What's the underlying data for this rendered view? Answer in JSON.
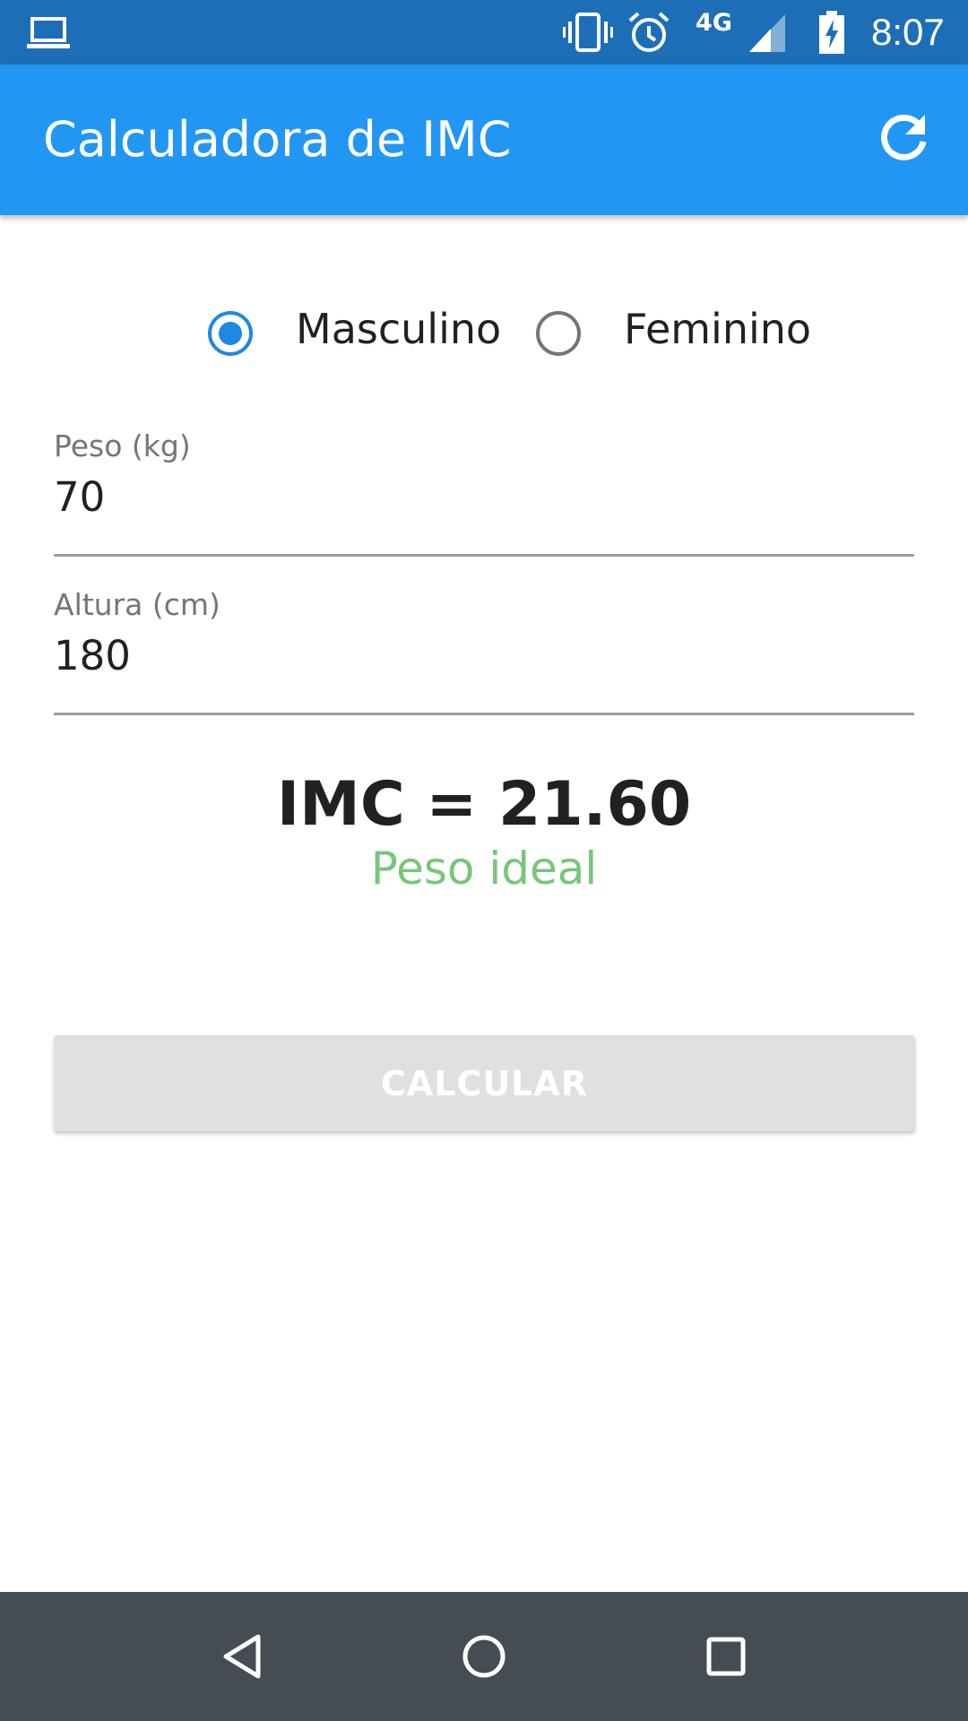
{
  "status_bar": {
    "network": "4G",
    "time": "8:07",
    "icons": [
      "laptop-icon",
      "vibrate-icon",
      "alarm-icon",
      "signal-icon",
      "battery-charging-icon"
    ]
  },
  "app_bar": {
    "title": "Calculadora de IMC",
    "refresh_icon": "refresh-icon"
  },
  "gender": {
    "options": [
      {
        "label": "Masculino",
        "selected": true
      },
      {
        "label": "Feminino",
        "selected": false
      }
    ]
  },
  "fields": {
    "peso": {
      "label": "Peso (kg)",
      "value": "70"
    },
    "altura": {
      "label": "Altura (cm)",
      "value": "180"
    }
  },
  "result": {
    "value_text": "IMC = 21.60",
    "status_text": "Peso ideal",
    "status_color": "#77c67b"
  },
  "button": {
    "label": "CALCULAR"
  },
  "colors": {
    "status_bar": "#1c6fb6",
    "app_bar": "#2296f3",
    "accent": "#1e88e5",
    "nav_bar": "#454c53"
  },
  "nav": {
    "icons": [
      "back-icon",
      "home-icon",
      "recents-icon"
    ]
  }
}
